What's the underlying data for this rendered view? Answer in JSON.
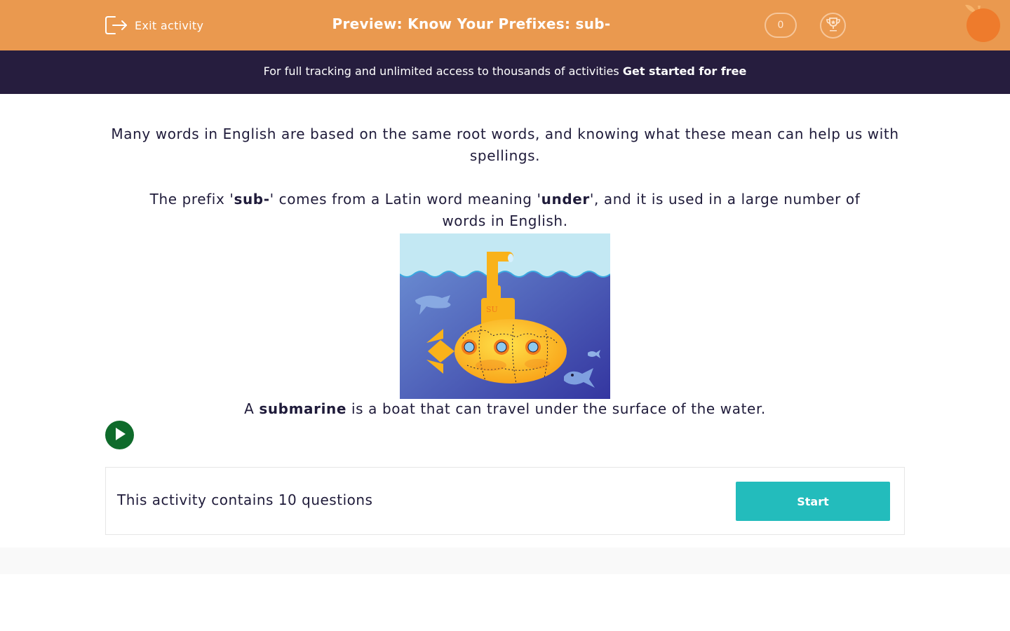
{
  "header": {
    "exit_label": "Exit activity",
    "title": "Preview: Know Your Prefixes: sub-",
    "score": "0",
    "accent_color": "#ea994f"
  },
  "promo": {
    "text": "For full tracking and unlimited access to thousands of activities ",
    "cta": "Get started for free",
    "background_color": "#261d3e"
  },
  "intro": {
    "paragraph1": "Many words in English are based on the same root words, and knowing what these mean can help us with spellings.",
    "paragraph2_before": "The prefix '",
    "paragraph2_bold1": "sub-",
    "paragraph2_middle": "' comes from a Latin word meaning '",
    "paragraph2_bold2": "under",
    "paragraph2_after": "', and it is used in a large number of words in English."
  },
  "illustration": {
    "hull_lettering": "SU"
  },
  "caption": {
    "before": "A ",
    "bold": "submarine",
    "after": " is a boat that can travel under the surface of the water."
  },
  "activity_card": {
    "text": "This activity contains 10 questions",
    "start_label": "Start",
    "button_color": "#23bcbc"
  },
  "icons": {
    "exit": "exit-icon",
    "trophy": "trophy-icon",
    "logo": "orange-logo-icon",
    "play": "play-icon"
  }
}
